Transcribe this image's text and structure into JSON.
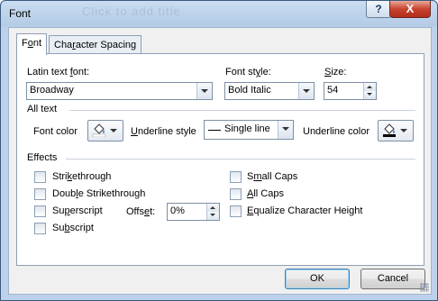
{
  "window": {
    "title": "Font",
    "ghost_title": "Click to add title",
    "help_label": "?",
    "close_label": "X"
  },
  "tabs": [
    {
      "label_pre": "F",
      "label_u": "o",
      "label_post": "nt"
    },
    {
      "label_pre": "Cha",
      "label_u": "r",
      "label_post": "acter Spacing"
    }
  ],
  "latin_font": {
    "label_pre": "Latin text ",
    "label_u": "f",
    "label_post": "ont:",
    "value": "Broadway"
  },
  "font_style": {
    "label_pre": "Font st",
    "label_u": "y",
    "label_post": "le:",
    "value": "Bold Italic"
  },
  "size": {
    "label_pre": "",
    "label_u": "S",
    "label_post": "ize:",
    "value": "54"
  },
  "all_text": {
    "heading": "All text",
    "font_color_label": "Font color",
    "underline_style_label_pre": "",
    "underline_style_label_u": "U",
    "underline_style_label_post": "nderline style",
    "underline_style_value": "Single line",
    "underline_color_label": "Underline color",
    "font_color": "#ffffff",
    "underline_color": "#000000"
  },
  "effects": {
    "heading": "Effects",
    "left": [
      {
        "pre": "Stri",
        "u": "k",
        "post": "ethrough",
        "checked": false
      },
      {
        "pre": "Doub",
        "u": "l",
        "post": "e Strikethrough",
        "checked": false
      },
      {
        "pre": "Su",
        "u": "p",
        "post": "erscript",
        "checked": false
      },
      {
        "pre": "Su",
        "u": "b",
        "post": "script",
        "checked": false
      }
    ],
    "right": [
      {
        "pre": "S",
        "u": "m",
        "post": "all Caps",
        "checked": false
      },
      {
        "pre": "",
        "u": "A",
        "post": "ll Caps",
        "checked": false
      },
      {
        "pre": "",
        "u": "E",
        "post": "qualize Character Height",
        "checked": false
      }
    ],
    "offset": {
      "label_pre": "Offs",
      "label_u": "e",
      "label_post": "t:",
      "value": "0%"
    }
  },
  "buttons": {
    "ok": "OK",
    "cancel": "Cancel"
  },
  "colors": {
    "accent": "#3c7fb1",
    "title_bar": "#b4cbe6",
    "close": "#c8432f"
  }
}
